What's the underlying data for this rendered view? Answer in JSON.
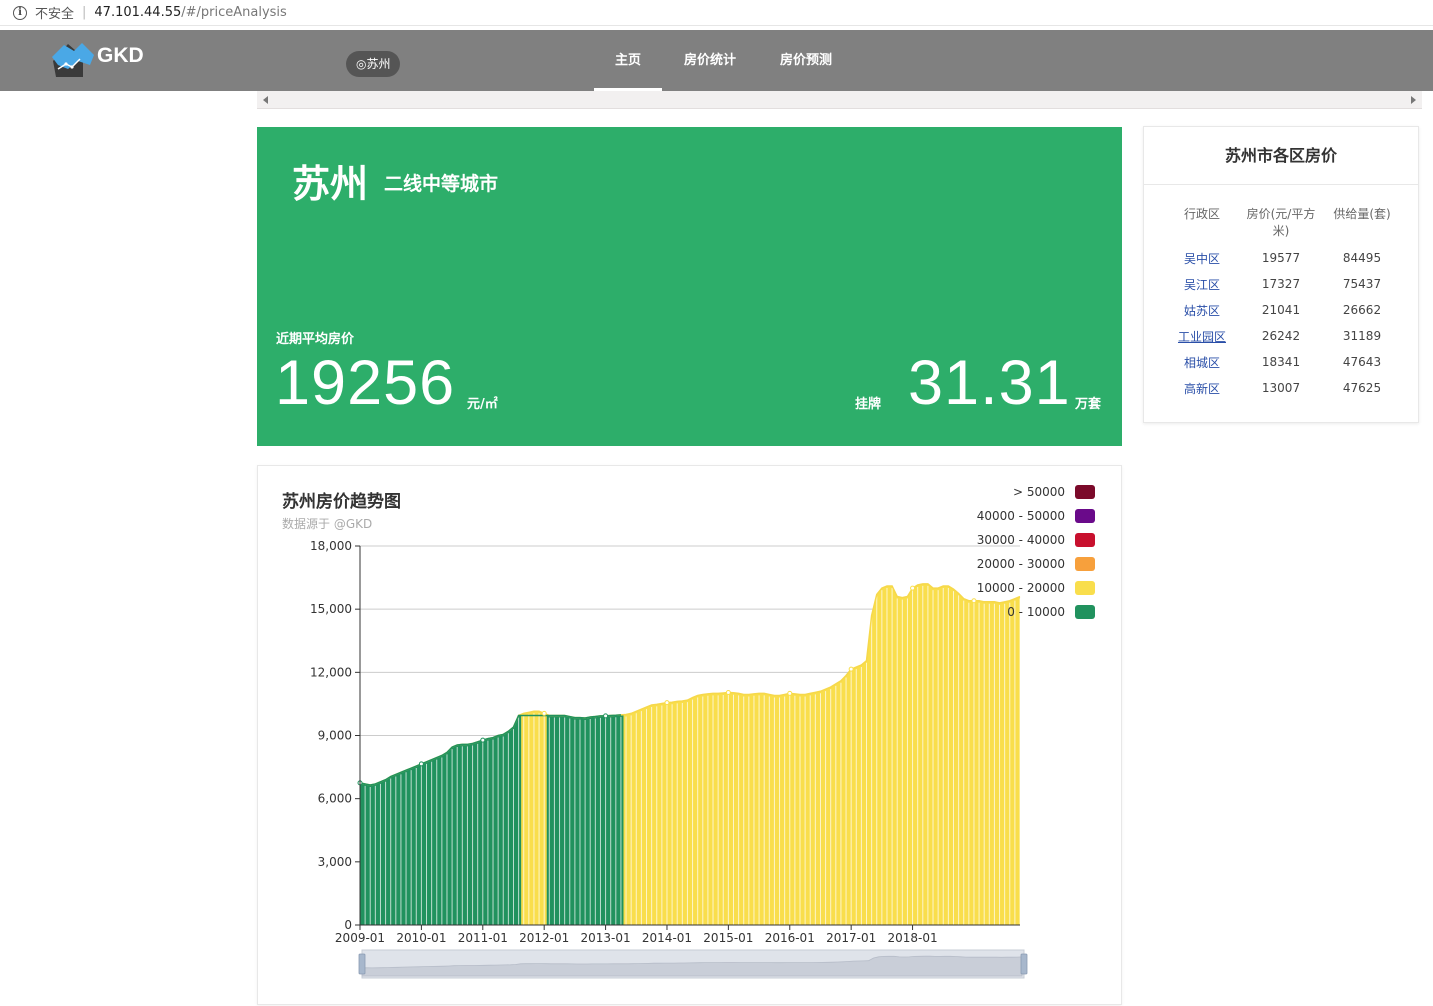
{
  "browser": {
    "security": "不安全",
    "url_host": "47.101.44.55",
    "url_path": "/#/priceAnalysis"
  },
  "navbar": {
    "brand": "GKD",
    "city": "◎苏州",
    "items": [
      {
        "label": "主页",
        "active": true
      },
      {
        "label": "房价统计",
        "active": false
      },
      {
        "label": "房价预测",
        "active": false
      }
    ]
  },
  "hero": {
    "city": "苏州",
    "tier": "二线中等城市",
    "avg_label": "近期平均房价",
    "avg_price": "19256",
    "avg_unit": "元/㎡",
    "listing_label": "挂牌",
    "listing_value": "31.31",
    "listing_unit": "万套"
  },
  "district": {
    "title": "苏州市各区房价",
    "headers": [
      "行政区",
      "房价(元/平方米)",
      "供给量(套)"
    ],
    "rows": [
      {
        "name": "吴中区",
        "price": "19577",
        "supply": "84495"
      },
      {
        "name": "吴江区",
        "price": "17327",
        "supply": "75437"
      },
      {
        "name": "姑苏区",
        "price": "21041",
        "supply": "26662"
      },
      {
        "name": "工业园区",
        "price": "26242",
        "supply": "31189"
      },
      {
        "name": "相城区",
        "price": "18341",
        "supply": "47643"
      },
      {
        "name": "高新区",
        "price": "13007",
        "supply": "47625"
      }
    ]
  },
  "chart": {
    "title": "苏州房价趋势图",
    "subtitle": "数据源于 @GKD",
    "legend": [
      {
        "label": "> 50000",
        "color": "#7b0a2a"
      },
      {
        "label": "40000 - 50000",
        "color": "#6a0a8a"
      },
      {
        "label": "30000 - 40000",
        "color": "#c8102e"
      },
      {
        "label": "20000 - 30000",
        "color": "#f7a03c"
      },
      {
        "label": "10000 - 20000",
        "color": "#f9de4c"
      },
      {
        "label": "0 - 10000",
        "color": "#21925e"
      }
    ]
  },
  "chart_data": {
    "type": "area",
    "title": "苏州房价趋势图",
    "subtitle": "数据源于 @GKD",
    "xlabel": "",
    "ylabel": "",
    "ylim": [
      0,
      18000
    ],
    "yticks": [
      "0",
      "3,000",
      "6,000",
      "9,000",
      "12,000",
      "15,000",
      "18,000"
    ],
    "xticks": [
      "2009-01",
      "2010-01",
      "2011-01",
      "2012-01",
      "2013-01",
      "2014-01",
      "2015-01",
      "2016-01",
      "2017-01",
      "2018-01"
    ],
    "visual_map": [
      {
        "range": "> 50000",
        "color": "#7b0a2a"
      },
      {
        "range": "40000 - 50000",
        "color": "#6a0a8a"
      },
      {
        "range": "30000 - 40000",
        "color": "#c8102e"
      },
      {
        "range": "20000 - 30000",
        "color": "#f7a03c"
      },
      {
        "range": "10000 - 20000",
        "color": "#f9de4c"
      },
      {
        "range": "0 - 10000",
        "color": "#21925e"
      }
    ],
    "start": "2009-01",
    "series": [
      {
        "values": [
          6750,
          6700,
          6650,
          6700,
          6800,
          6900,
          7050,
          7150,
          7250,
          7350,
          7450,
          7550,
          7650,
          7750,
          7850,
          7950,
          8050,
          8200,
          8450,
          8550,
          8580,
          8580,
          8620,
          8700,
          8780,
          8850,
          8900,
          9000,
          9050,
          9200,
          9400,
          9950,
          10050,
          10100,
          10150,
          10150,
          10050,
          9950,
          9950,
          9950,
          9950,
          9900,
          9850,
          9850,
          9830,
          9880,
          9900,
          9930,
          9930,
          9950,
          9960,
          9980,
          10000,
          10050,
          10150,
          10250,
          10350,
          10450,
          10480,
          10520,
          10560,
          10580,
          10620,
          10640,
          10680,
          10800,
          10900,
          10950,
          10980,
          11000,
          11000,
          11020,
          11040,
          11030,
          11000,
          10950,
          10950,
          10980,
          11000,
          11000,
          10950,
          10900,
          10900,
          10950,
          11000,
          10980,
          10950,
          10950,
          11000,
          11050,
          11100,
          11200,
          11300,
          11450,
          11600,
          11850,
          12150,
          12250,
          12350,
          12550,
          14700,
          15700,
          16000,
          16100,
          16100,
          15600,
          15550,
          15600,
          16000,
          16150,
          16200,
          16200,
          16000,
          16000,
          16100,
          16100,
          15950,
          15750,
          15500,
          15400,
          15400,
          15400,
          15350,
          15350,
          15350,
          15300,
          15350,
          15400,
          15500,
          15600
        ]
      }
    ]
  }
}
